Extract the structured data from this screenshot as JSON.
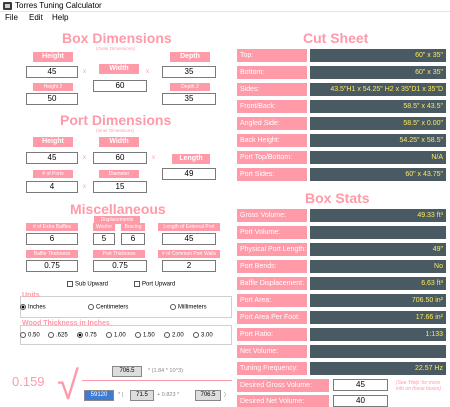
{
  "window": {
    "title": "Torres Tuning Calculator"
  },
  "menu": [
    "File",
    "Edit",
    "Help"
  ],
  "box_dimensions": {
    "heading": "Box Dimensions",
    "subheading": "(Outer Dimensions)",
    "height_label": "Height",
    "height": "45",
    "width_label": "Width",
    "width": "60",
    "depth_label": "Depth",
    "depth": "35",
    "height2_label": "Height 2",
    "height2": "50",
    "depth2_label": "Depth 2",
    "depth2": "35",
    "x": "x"
  },
  "port_dimensions": {
    "heading": "Port Dimensions",
    "subheading": "(Inner Dimensions)",
    "height_label": "Height",
    "height": "45",
    "width_label": "Width",
    "width": "60",
    "length_label": "Length",
    "length": "49",
    "num_ports_label": "# of Ports",
    "num_ports": "4",
    "diameter_label": "Diameter",
    "diameter": "15",
    "x": "x"
  },
  "miscellaneous": {
    "heading": "Miscellaneous",
    "displacements_label": "Displacements",
    "extra_baffles_label": "# of Extra Baffles",
    "extra_baffles": "6",
    "woofer_label": "Woofer",
    "woofer": "5",
    "bracing_label": "Bracing",
    "bracing": "6",
    "ext_port_label": "Length of External Port",
    "ext_port": "45",
    "baffle_thickness_label": "Baffle Thickness",
    "baffle_thickness": "0.75",
    "port_thickness_label": "Port Thickness",
    "port_thickness": "0.75",
    "common_port_walls_label": "# of Common Port Walls",
    "common_port_walls": "2",
    "sub_upward": "Sub Upward",
    "port_upward": "Port Upward"
  },
  "units": {
    "label": "Units",
    "options": [
      "Inches",
      "Centimeters",
      "Millimeters"
    ],
    "selected": 0
  },
  "wood": {
    "label": "Wood Thickness in Inches",
    "options": [
      "0.50",
      ".625",
      "0.75",
      "1.00",
      "1.50",
      "2.00",
      "3.00"
    ],
    "selected": 2
  },
  "cut_sheet": {
    "heading": "Cut Sheet",
    "rows": [
      {
        "label": "Top:",
        "value": "60\" x 35\""
      },
      {
        "label": "Bottom:",
        "value": "60\" x 35\""
      },
      {
        "label": "Sides:",
        "value": "43.5\"H1 x 54.25\" H2 x 35\"D1 x 35\"D"
      },
      {
        "label": "Front/Back:",
        "value": "58.5\" x 43.5\""
      },
      {
        "label": "Angled Side:",
        "value": "58.5\" x 0.00\""
      },
      {
        "label": "Back Height:",
        "value": "54.25\" x 58.5\""
      },
      {
        "label": "Port Top/Bottom:",
        "value": "N/A"
      },
      {
        "label": "Port Sides:",
        "value": "60\" x 43.75\""
      }
    ]
  },
  "box_stats": {
    "heading": "Box Stats",
    "rows": [
      {
        "label": "Gross Volume:",
        "value": "49.33 ft³"
      },
      {
        "label": "Port Volume:",
        "value": ""
      },
      {
        "label": "Physical Port Length:",
        "value": "49\""
      },
      {
        "label": "Port Bends:",
        "value": "No"
      },
      {
        "label": "Baffle Displacement:",
        "value": "6.63 ft³"
      },
      {
        "label": "Port Area:",
        "value": "706.50 in²"
      },
      {
        "label": "Port Area Per Foot:",
        "value": "17.66 in²"
      },
      {
        "label": "Port Ratio:",
        "value": "1:133"
      },
      {
        "label": "Net Volume:",
        "value": ""
      },
      {
        "label": "Tuning Frequency:",
        "value": "22.57 Hz"
      }
    ],
    "desired_gross_label": "Desired Gross Volume:",
    "desired_gross": "45",
    "desired_net_label": "Desired Net Volume:",
    "desired_net": "40",
    "note": "(See 'Help' for more info on these boxes)"
  },
  "formula": {
    "coef": "0.159",
    "top_box": "706.5",
    "top_text": "* (1.84 * 10^3)",
    "left_box": "59120",
    "paren_open": "* (",
    "mid_box": "71.5",
    "mid_text": "+ 0.823 *",
    "right_box": "706.5",
    "paren_close": ")"
  },
  "colors": {
    "accent": "#ff9aa8",
    "value_bg": "#4a5a63",
    "value_text": "#ffe95a"
  }
}
